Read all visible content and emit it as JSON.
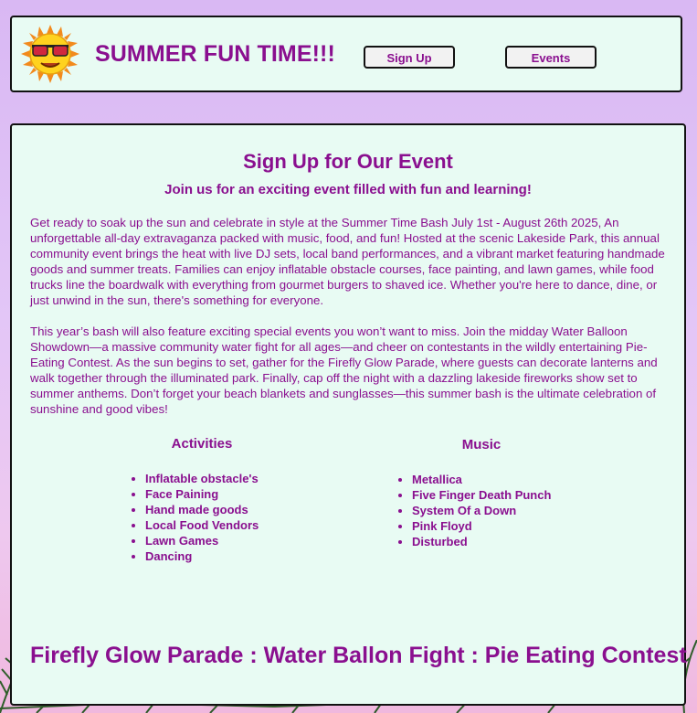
{
  "header": {
    "title": "SUMMER FUN TIME!!!",
    "nav": [
      {
        "label": "Sign Up"
      },
      {
        "label": "Events"
      }
    ]
  },
  "main": {
    "heading": "Sign Up for Our Event",
    "subheading": "Join us for an exciting event filled with fun and learning!",
    "paragraphs": [
      "Get ready to soak up the sun and celebrate in style at the Summer Time Bash July 1st - August 26th 2025, An unforgettable all-day extravaganza packed with music, food, and fun! Hosted at the scenic Lakeside Park, this annual community event brings the heat with live DJ sets, local band performances, and a vibrant market featuring handmade goods and summer treats. Families can enjoy inflatable obstacle courses, face painting, and lawn games, while food trucks line the boardwalk with everything from gourmet burgers to shaved ice. Whether you're here to dance, dine, or just unwind in the sun, there's something for everyone.",
      "This year’s bash will also feature exciting special events you won’t want to miss. Join the midday Water Balloon Showdown—a massive community water fight for all ages—and cheer on contestants in the wildly entertaining Pie-Eating Contest. As the sun begins to set, gather for the Firefly Glow Parade, where guests can decorate lanterns and walk together through the illuminated park. Finally, cap off the night with a dazzling lakeside fireworks show set to summer anthems. Don’t forget your beach blankets and sunglasses—this summer bash is the ultimate celebration of sunshine and good vibes!"
    ],
    "activities": {
      "heading": "Activities",
      "items": [
        "Inflatable obstacle's",
        "Face Paining",
        "Hand made goods",
        "Local Food Vendors",
        "Lawn Games",
        "Dancing"
      ]
    },
    "music": {
      "heading": "Music",
      "items": [
        "Metallica",
        "Five Finger Death Punch",
        "System Of a Down",
        "Pink Floyd",
        "Disturbed"
      ]
    },
    "footer_events": [
      "Firefly Glow Parade",
      ":",
      "Water Ballon Fight",
      ":",
      "Pie Eating Contest"
    ]
  },
  "colors": {
    "accent": "#8a0f8f",
    "panel": "#e8fbf3",
    "border": "#111111"
  },
  "icons": [
    "sun-with-sunglasses-icon",
    "palm-leaf-decoration"
  ]
}
